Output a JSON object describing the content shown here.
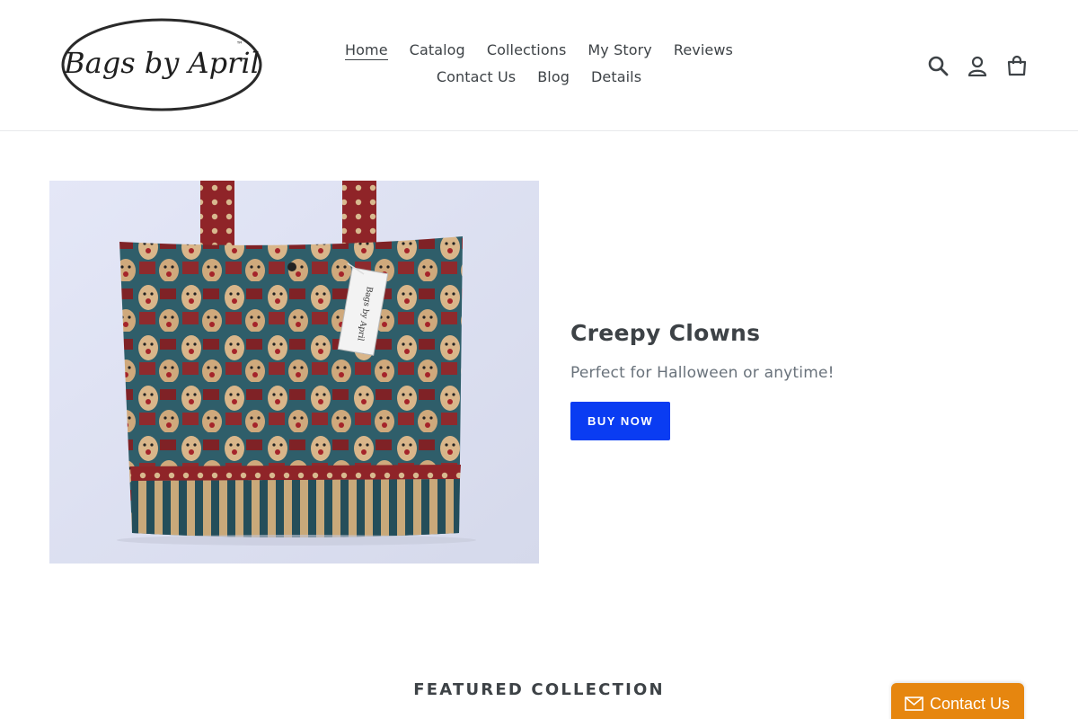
{
  "brand": {
    "logo_text": "Bags by April",
    "logo_tm": "™"
  },
  "nav": {
    "row1": [
      {
        "label": "Home",
        "active": true
      },
      {
        "label": "Catalog"
      },
      {
        "label": "Collections"
      },
      {
        "label": "My Story"
      },
      {
        "label": "Reviews"
      }
    ],
    "row2": [
      {
        "label": "Contact Us"
      },
      {
        "label": "Blog"
      },
      {
        "label": "Details"
      }
    ]
  },
  "header_icons": [
    "search-icon",
    "account-icon",
    "cart-icon"
  ],
  "hero": {
    "title": "Creepy Clowns",
    "subtitle": "Perfect for Halloween or anytime!",
    "button_label": "BUY NOW",
    "tag_text": "Bags by April"
  },
  "featured": {
    "title": "FEATURED COLLECTION"
  },
  "contact_widget": {
    "label": "Contact Us",
    "icon": "envelope-icon"
  },
  "colors": {
    "accent": "#0a3cf2",
    "contact_widget": "#e6860f",
    "text": "#3d4246",
    "muted": "#69727b"
  }
}
